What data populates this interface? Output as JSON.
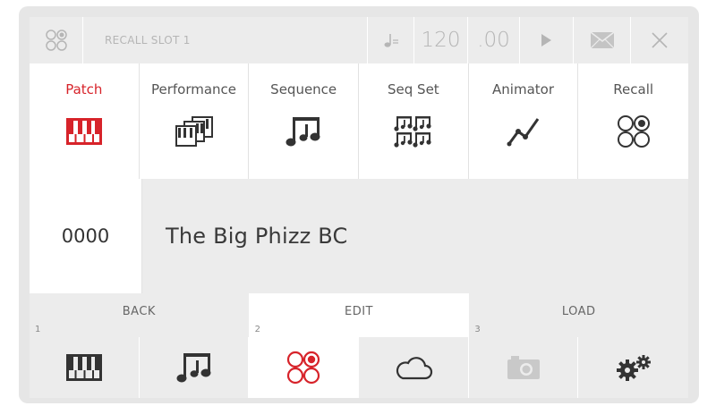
{
  "topbar": {
    "recall_icon": "recall-slots-icon",
    "title": "RECALL SLOT 1",
    "tempo_icon": "quarter-note-tempo-icon",
    "tempo": "120",
    "tempo_fraction": ".00",
    "play_icon": "play-icon",
    "mail_icon": "envelope-icon",
    "close_icon": "close-icon"
  },
  "nav": {
    "tabs": [
      {
        "label": "Patch",
        "icon": "piano-keys-icon",
        "active": true
      },
      {
        "label": "Performance",
        "icon": "layered-keys-icon"
      },
      {
        "label": "Sequence",
        "icon": "music-notes-icon"
      },
      {
        "label": "Seq Set",
        "icon": "multi-notes-icon"
      },
      {
        "label": "Animator",
        "icon": "automation-curve-icon"
      },
      {
        "label": "Recall",
        "icon": "recall-slots-icon"
      }
    ]
  },
  "patch": {
    "number": "0000",
    "name": "The Big Phizz BC"
  },
  "softkeys": [
    {
      "label": "BACK",
      "num": "1"
    },
    {
      "label": "EDIT",
      "num": "2",
      "active": true
    },
    {
      "label": "LOAD",
      "num": "3"
    }
  ],
  "bottom": [
    {
      "icon": "piano-keys-icon"
    },
    {
      "icon": "music-notes-icon"
    },
    {
      "icon": "recall-slots-icon",
      "active": true
    },
    {
      "icon": "cloud-icon"
    },
    {
      "icon": "camera-icon",
      "disabled": true
    },
    {
      "icon": "gears-icon"
    }
  ],
  "colors": {
    "accent": "#d7232a",
    "panel": "#ececec",
    "text": "#3a3a3a",
    "muted": "#b5b5b5"
  }
}
